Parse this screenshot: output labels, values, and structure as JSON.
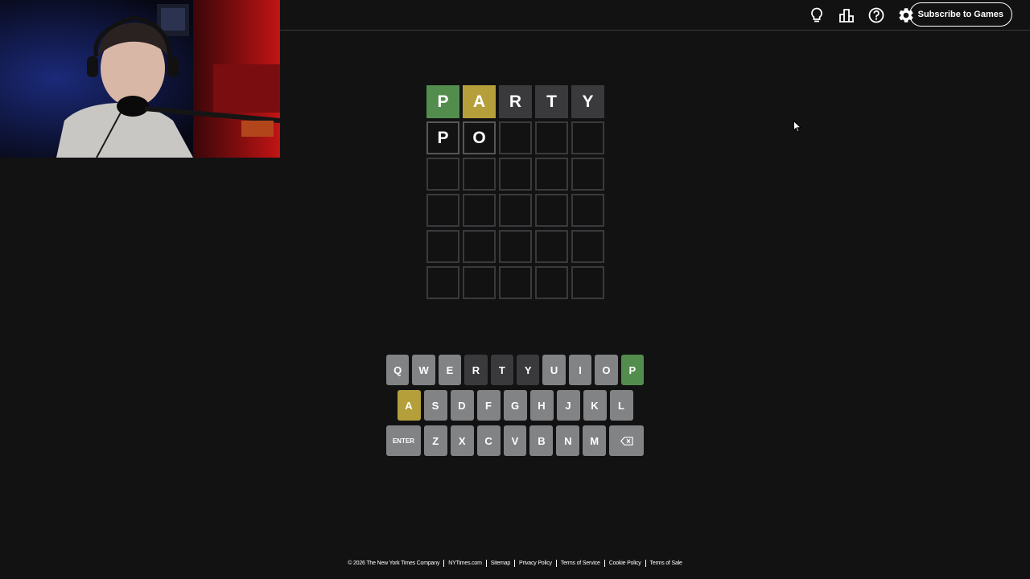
{
  "header": {
    "icons": [
      {
        "name": "hint-bulb-icon",
        "label": "Hint"
      },
      {
        "name": "stats-icon",
        "label": "Statistics"
      },
      {
        "name": "help-icon",
        "label": "Help"
      },
      {
        "name": "settings-gear-icon",
        "label": "Settings"
      }
    ],
    "subscribe_label": "Subscribe to Games"
  },
  "board": {
    "rows": [
      [
        {
          "letter": "P",
          "state": "correct"
        },
        {
          "letter": "A",
          "state": "present"
        },
        {
          "letter": "R",
          "state": "absent"
        },
        {
          "letter": "T",
          "state": "absent"
        },
        {
          "letter": "Y",
          "state": "absent"
        }
      ],
      [
        {
          "letter": "P",
          "state": "filled"
        },
        {
          "letter": "O",
          "state": "filled"
        },
        {
          "letter": "",
          "state": "empty"
        },
        {
          "letter": "",
          "state": "empty"
        },
        {
          "letter": "",
          "state": "empty"
        }
      ],
      [
        {
          "letter": "",
          "state": "empty"
        },
        {
          "letter": "",
          "state": "empty"
        },
        {
          "letter": "",
          "state": "empty"
        },
        {
          "letter": "",
          "state": "empty"
        },
        {
          "letter": "",
          "state": "empty"
        }
      ],
      [
        {
          "letter": "",
          "state": "empty"
        },
        {
          "letter": "",
          "state": "empty"
        },
        {
          "letter": "",
          "state": "empty"
        },
        {
          "letter": "",
          "state": "empty"
        },
        {
          "letter": "",
          "state": "empty"
        }
      ],
      [
        {
          "letter": "",
          "state": "empty"
        },
        {
          "letter": "",
          "state": "empty"
        },
        {
          "letter": "",
          "state": "empty"
        },
        {
          "letter": "",
          "state": "empty"
        },
        {
          "letter": "",
          "state": "empty"
        }
      ],
      [
        {
          "letter": "",
          "state": "empty"
        },
        {
          "letter": "",
          "state": "empty"
        },
        {
          "letter": "",
          "state": "empty"
        },
        {
          "letter": "",
          "state": "empty"
        },
        {
          "letter": "",
          "state": "empty"
        }
      ]
    ]
  },
  "keyboard": {
    "rows": [
      [
        {
          "label": "Q",
          "state": "unused"
        },
        {
          "label": "W",
          "state": "unused"
        },
        {
          "label": "E",
          "state": "unused"
        },
        {
          "label": "R",
          "state": "absent"
        },
        {
          "label": "T",
          "state": "absent"
        },
        {
          "label": "Y",
          "state": "absent"
        },
        {
          "label": "U",
          "state": "unused"
        },
        {
          "label": "I",
          "state": "unused"
        },
        {
          "label": "O",
          "state": "unused"
        },
        {
          "label": "P",
          "state": "correct"
        }
      ],
      [
        {
          "label": "A",
          "state": "present"
        },
        {
          "label": "S",
          "state": "unused"
        },
        {
          "label": "D",
          "state": "unused"
        },
        {
          "label": "F",
          "state": "unused"
        },
        {
          "label": "G",
          "state": "unused"
        },
        {
          "label": "H",
          "state": "unused"
        },
        {
          "label": "J",
          "state": "unused"
        },
        {
          "label": "K",
          "state": "unused"
        },
        {
          "label": "L",
          "state": "unused"
        }
      ],
      [
        {
          "label": "ENTER",
          "state": "unused",
          "wide": true
        },
        {
          "label": "Z",
          "state": "unused"
        },
        {
          "label": "X",
          "state": "unused"
        },
        {
          "label": "C",
          "state": "unused"
        },
        {
          "label": "V",
          "state": "unused"
        },
        {
          "label": "B",
          "state": "unused"
        },
        {
          "label": "N",
          "state": "unused"
        },
        {
          "label": "M",
          "state": "unused"
        },
        {
          "label": "",
          "state": "unused",
          "wide": true,
          "icon": "backspace-icon"
        }
      ]
    ]
  },
  "footer": {
    "copyright": "© 2026 The New York Times Company",
    "links": [
      "NYTimes.com",
      "Sitemap",
      "Privacy Policy",
      "Terms of Service",
      "Cookie Policy",
      "Terms of Sale"
    ]
  },
  "colors": {
    "background": "#121213",
    "correct": "#538d4e",
    "present": "#b59f3b",
    "absent": "#3a3a3c",
    "key_default": "#818384",
    "tile_border": "#3a3a3c"
  }
}
